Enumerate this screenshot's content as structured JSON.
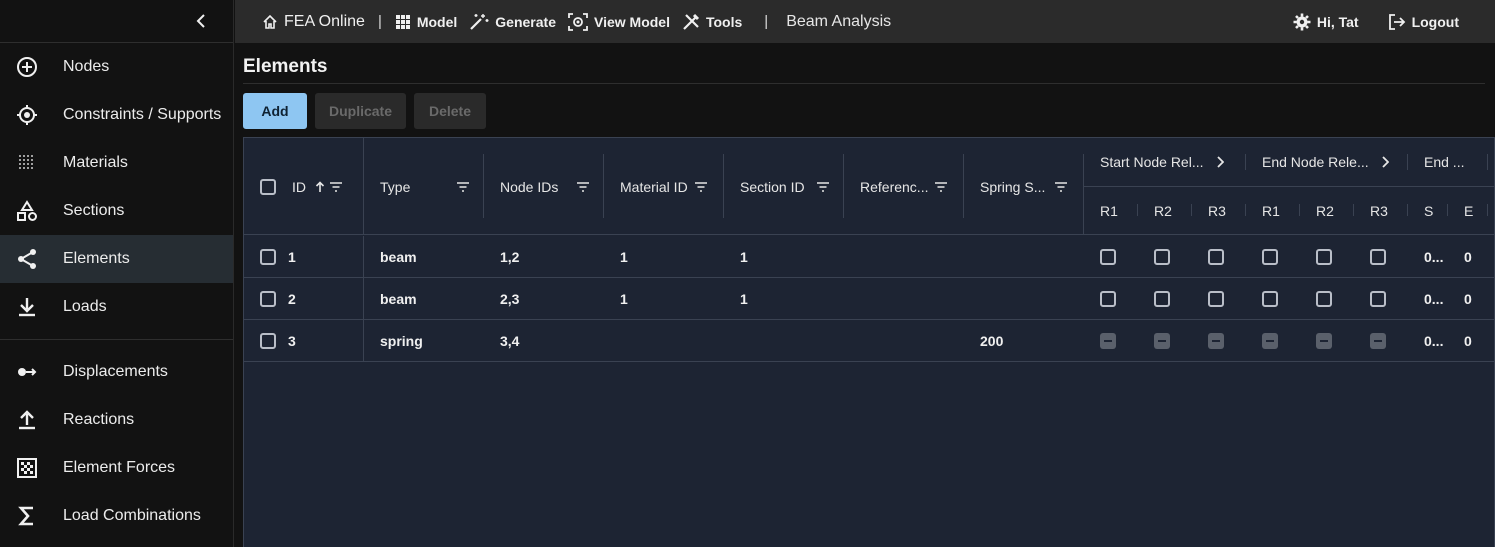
{
  "topbar": {
    "brand": "FEA Online",
    "menu": [
      {
        "label": "Model",
        "icon": "grid-icon"
      },
      {
        "label": "Generate",
        "icon": "magic-wand-icon"
      },
      {
        "label": "View Model",
        "icon": "view-scan-icon"
      },
      {
        "label": "Tools",
        "icon": "tools-icon"
      }
    ],
    "project_name": "Beam Analysis",
    "user_greeting": "Hi, Tat",
    "logout_label": "Logout"
  },
  "sidebar": {
    "model_items": [
      {
        "label": "Nodes",
        "icon": "plus-circle-icon"
      },
      {
        "label": "Constraints / Supports",
        "icon": "target-icon"
      },
      {
        "label": "Materials",
        "icon": "dots-grid-icon"
      },
      {
        "label": "Sections",
        "icon": "shapes-icon"
      },
      {
        "label": "Elements",
        "icon": "share-nodes-icon",
        "active": true
      },
      {
        "label": "Loads",
        "icon": "download-icon"
      }
    ],
    "result_items": [
      {
        "label": "Displacements",
        "icon": "displacement-arrow-icon"
      },
      {
        "label": "Reactions",
        "icon": "upload-icon"
      },
      {
        "label": "Element Forces",
        "icon": "checker-grid-icon"
      },
      {
        "label": "Load Combinations",
        "icon": "sigma-icon"
      }
    ]
  },
  "page": {
    "title": "Elements",
    "buttons": {
      "add": "Add",
      "duplicate": "Duplicate",
      "delete": "Delete"
    }
  },
  "table": {
    "columns": {
      "id": "ID",
      "type": "Type",
      "node_ids": "Node IDs",
      "material_id": "Material ID",
      "section_id": "Section ID",
      "reference": "Referenc...",
      "spring": "Spring S..."
    },
    "groups": {
      "start_release": "Start Node Rel...",
      "end_release": "End Node Rele...",
      "end_offset": "End ..."
    },
    "sub_columns": {
      "start": [
        "R1",
        "R2",
        "R3"
      ],
      "end": [
        "R1",
        "R2",
        "R3"
      ],
      "offset": [
        "S",
        "E"
      ]
    },
    "rows": [
      {
        "id": "1",
        "type": "beam",
        "node_ids": "1,2",
        "material_id": "1",
        "section_id": "1",
        "reference": "",
        "spring": "",
        "releases_enabled": true,
        "offset_s": "0...",
        "offset_e": "0"
      },
      {
        "id": "2",
        "type": "beam",
        "node_ids": "2,3",
        "material_id": "1",
        "section_id": "1",
        "reference": "",
        "spring": "",
        "releases_enabled": true,
        "offset_s": "0...",
        "offset_e": "0"
      },
      {
        "id": "3",
        "type": "spring",
        "node_ids": "3,4",
        "material_id": "",
        "section_id": "",
        "reference": "",
        "spring": "200",
        "releases_enabled": false,
        "offset_s": "0...",
        "offset_e": "0"
      }
    ]
  },
  "colors": {
    "primary_button": "#8ec6f2",
    "active_nav": "#262d33",
    "grid_background": "#1d2433",
    "topbar": "#2b2b2b"
  }
}
